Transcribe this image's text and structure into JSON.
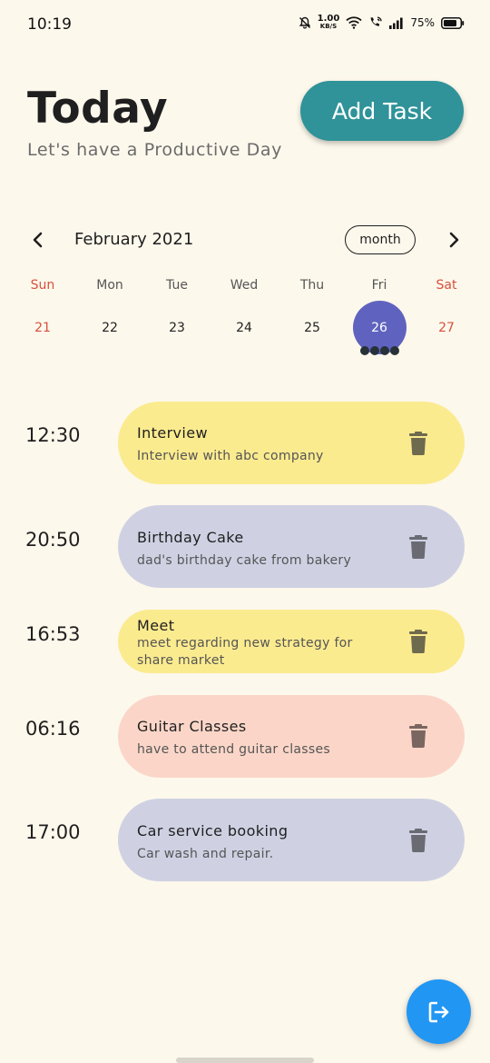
{
  "status_bar": {
    "time": "10:19",
    "speed_value": "1.00",
    "speed_unit": "KB/S",
    "battery": "75%"
  },
  "header": {
    "title": "Today",
    "subtitle": "Let's have a Productive Day",
    "add_task_label": "Add Task"
  },
  "calendar": {
    "month_label": "February 2021",
    "format_label": "month",
    "weekdays": [
      "Sun",
      "Mon",
      "Tue",
      "Wed",
      "Thu",
      "Fri",
      "Sat"
    ],
    "days": [
      "21",
      "22",
      "23",
      "24",
      "25",
      "26",
      "27"
    ],
    "selected_day": "26",
    "selected_color": "#5f63bf"
  },
  "tasks": [
    {
      "time": "12:30",
      "title": "Interview",
      "note": "Interview with abc company",
      "color": "#fbeb8f"
    },
    {
      "time": "20:50",
      "title": "Birthday Cake",
      "note": "dad's birthday cake from bakery",
      "color": "#cfd1e3"
    },
    {
      "time": "16:53",
      "title": "Meet",
      "note": "meet regarding new strategy for share market",
      "color": "#fbeb8f"
    },
    {
      "time": "06:16",
      "title": "Guitar Classes",
      "note": "have to attend guitar classes",
      "color": "#fbd6c8"
    },
    {
      "time": "17:00",
      "title": "Car service booking",
      "note": "Car wash and repair.",
      "color": "#cfd1e3"
    }
  ],
  "colors": {
    "background": "#fdf8ec",
    "add_task_button": "#2f9399",
    "fab": "#2196f3",
    "weekend": "#d9503d"
  },
  "icons": {
    "fab": "logout-icon",
    "task_action": "trash-icon"
  }
}
